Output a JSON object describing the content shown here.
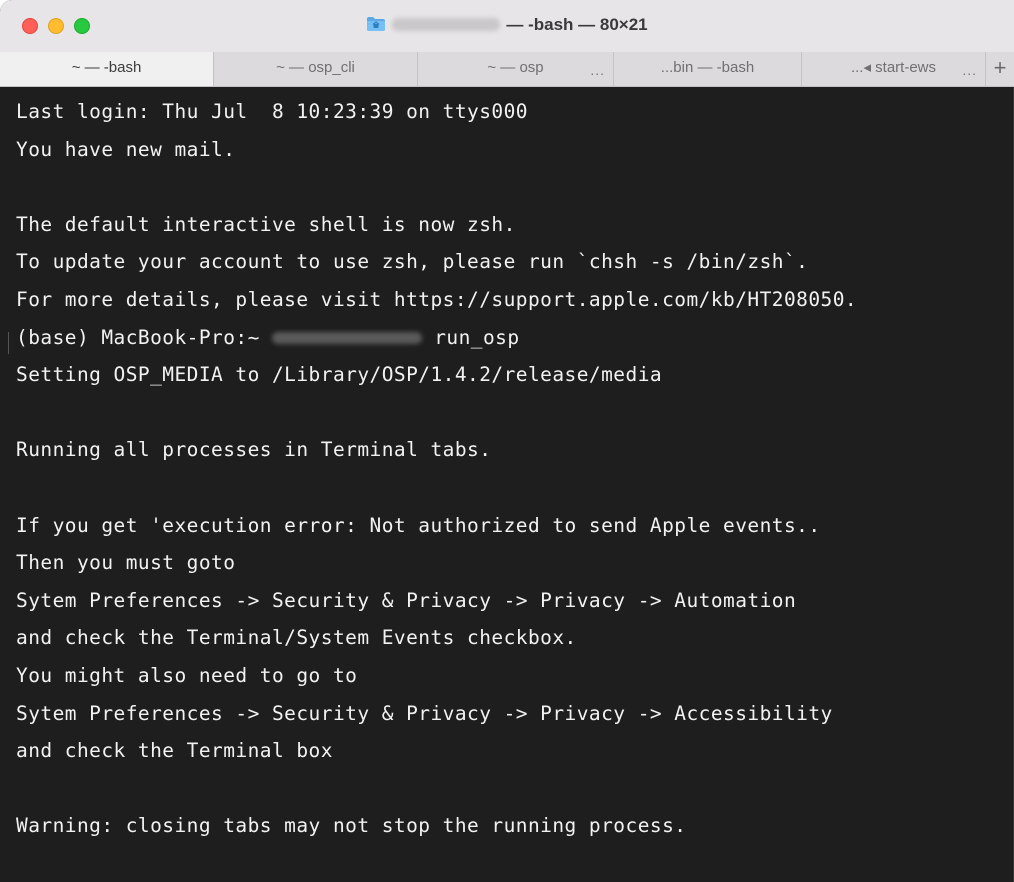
{
  "window": {
    "title_suffix": "— -bash — 80×21",
    "folder_icon": "folder-icon"
  },
  "tabs": [
    {
      "label": "~ — -bash",
      "active": true
    },
    {
      "label": "~ — osp_cli",
      "active": false
    },
    {
      "label": "~ — osp",
      "active": false,
      "more": "..."
    },
    {
      "label": "...bin — -bash",
      "active": false
    },
    {
      "label": "...◂ start-ews",
      "active": false,
      "more": "..."
    }
  ],
  "new_tab_label": "+",
  "terminal": {
    "lines": [
      "Last login: Thu Jul  8 10:23:39 on ttys000",
      "You have new mail.",
      "",
      "The default interactive shell is now zsh.",
      "To update your account to use zsh, please run `chsh -s /bin/zsh`.",
      "For more details, please visit https://support.apple.com/kb/HT208050.",
      "",
      "Setting OSP_MEDIA to /Library/OSP/1.4.2/release/media",
      "",
      "Running all processes in Terminal tabs.",
      "",
      "If you get 'execution error: Not authorized to send Apple events..",
      "Then you must goto",
      "Sytem Preferences -> Security & Privacy -> Privacy -> Automation",
      "and check the Terminal/System Events checkbox.",
      "You might also need to go to",
      "Sytem Preferences -> Security & Privacy -> Privacy -> Accessibility",
      "and check the Terminal box",
      "",
      "Warning: closing tabs may not stop the running process."
    ],
    "prompt": {
      "prefix": "(base) MacBook-Pro:~ ",
      "command": " run_osp"
    }
  },
  "colors": {
    "terminal_bg": "#1e1e1e",
    "terminal_fg": "#f2f2f2",
    "close": "#ff5f57",
    "minimize": "#febc2e",
    "zoom": "#28c840"
  }
}
